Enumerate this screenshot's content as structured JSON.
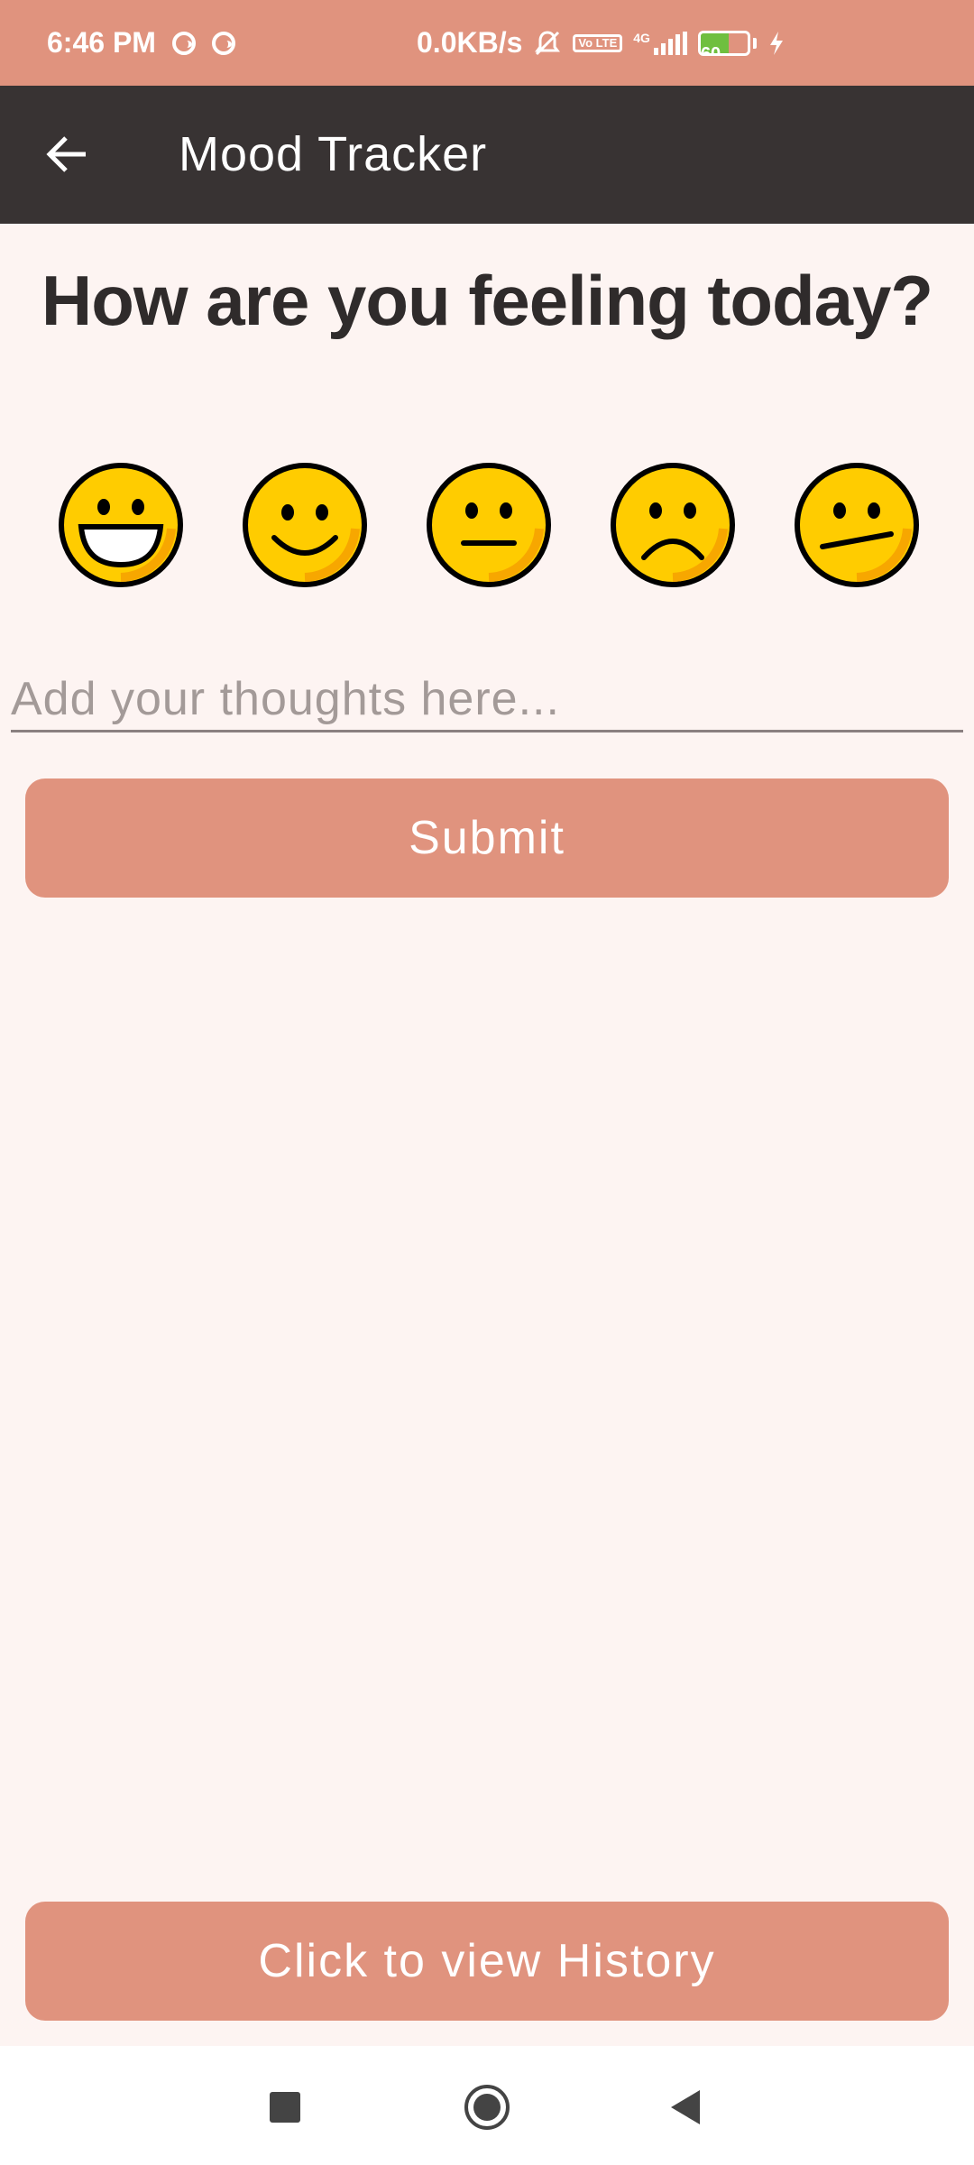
{
  "status_bar": {
    "time": "6:46 PM",
    "network_speed": "0.0KB/s",
    "network_type": "4G",
    "volte": "Vo LTE",
    "battery_level": "60",
    "battery_fraction": 0.6,
    "icons": [
      "sync-icon",
      "sync-icon",
      "mute-icon",
      "volte-icon",
      "signal-icon",
      "battery-icon",
      "charging-icon"
    ]
  },
  "app_bar": {
    "title": "Mood Tracker",
    "back_icon": "arrow-left-icon"
  },
  "main": {
    "question": "How are you feeling today?",
    "moods": [
      {
        "name": "very-happy",
        "icon": "grinning-face-icon"
      },
      {
        "name": "happy",
        "icon": "smiling-face-icon"
      },
      {
        "name": "neutral",
        "icon": "neutral-face-icon"
      },
      {
        "name": "sad",
        "icon": "frowning-face-icon"
      },
      {
        "name": "confused",
        "icon": "confused-face-icon"
      }
    ],
    "thoughts_placeholder": "Add your thoughts here...",
    "submit_label": "Submit",
    "history_label": "Click to view History"
  },
  "nav_bar": {
    "items": [
      "recents-icon",
      "home-icon",
      "back-icon"
    ]
  },
  "colors": {
    "accent": "#e0937e",
    "app_bar": "#383333",
    "background": "#fdf4f2",
    "emoji_face": "#ffcc00",
    "emoji_outline": "#000000"
  }
}
